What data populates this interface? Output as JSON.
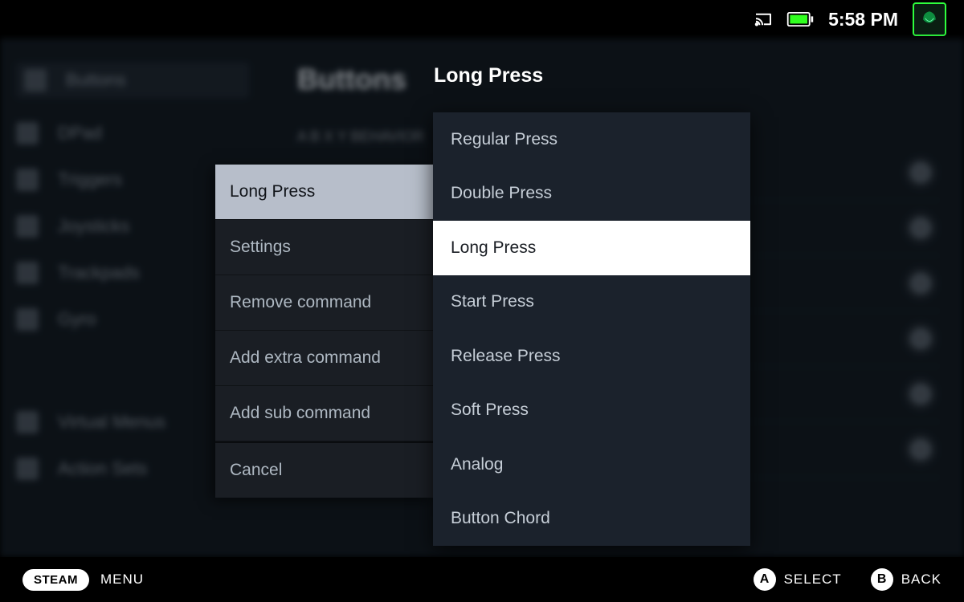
{
  "header": {
    "clock": "5:58 PM"
  },
  "background": {
    "section_title": "Buttons",
    "sidebar": [
      "Buttons",
      "DPad",
      "Triggers",
      "Joysticks",
      "Trackpads",
      "Gyro"
    ],
    "sidebar_more": [
      "Virtual Menus",
      "Action Sets"
    ],
    "sub_header": "A B X Y BEHAVIOR"
  },
  "dropdown": {
    "title": "Long Press",
    "items": [
      "Regular Press",
      "Double Press",
      "Long Press",
      "Start Press",
      "Release Press",
      "Soft Press",
      "Analog",
      "Button Chord"
    ],
    "selected_index": 2
  },
  "context_menu": {
    "items": [
      "Long Press",
      "Settings",
      "Remove command",
      "Add extra command",
      "Add sub command",
      "Cancel"
    ],
    "active_index": 0,
    "divider_before": 5
  },
  "footer": {
    "steam_pill": "STEAM",
    "menu": "MENU",
    "buttons": [
      {
        "glyph": "A",
        "label": "SELECT"
      },
      {
        "glyph": "B",
        "label": "BACK"
      }
    ]
  }
}
